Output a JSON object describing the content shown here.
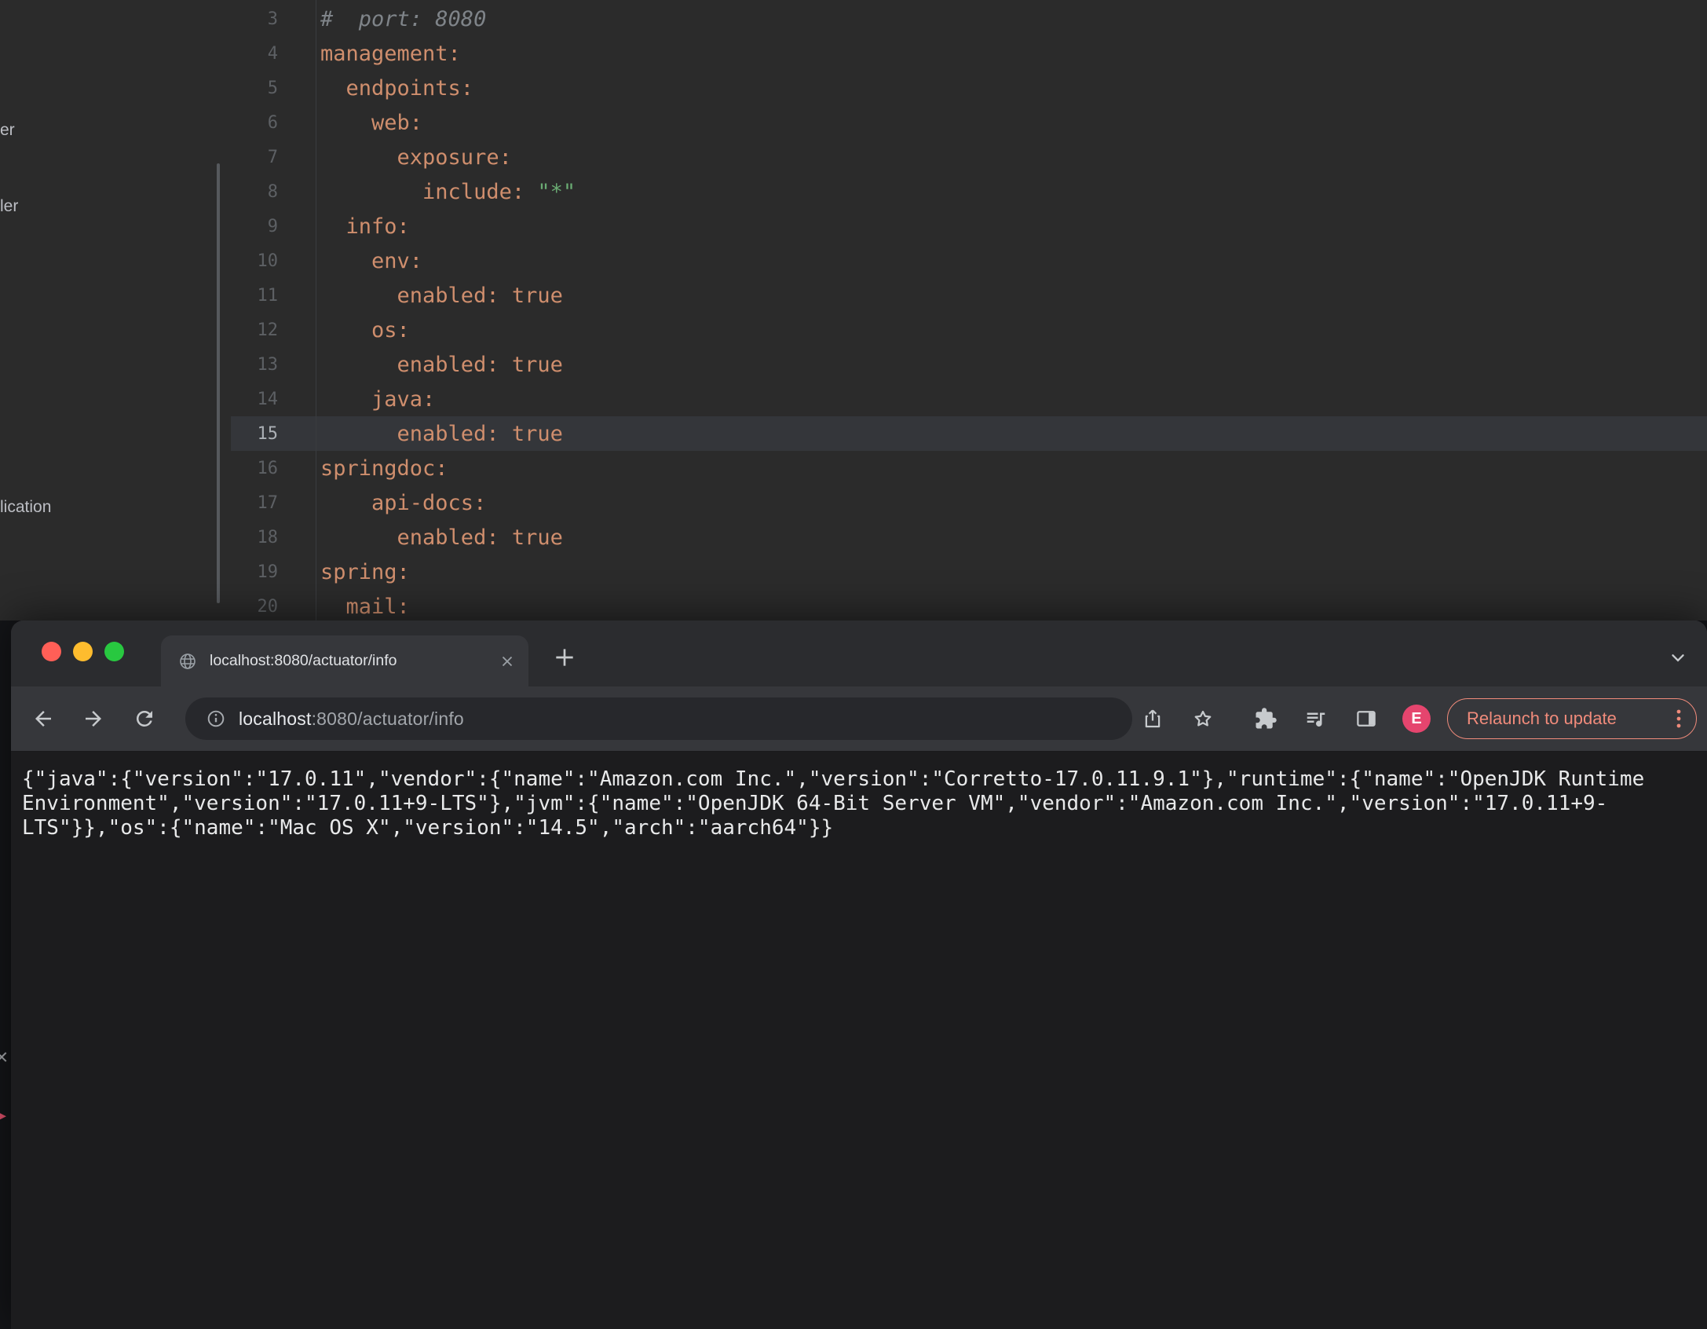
{
  "ide": {
    "sidebar_items": [
      {
        "label": "er"
      },
      {
        "label": "ler"
      },
      {
        "label": "lication"
      }
    ],
    "edge_glyphs": [
      "×",
      "▸"
    ],
    "editor_lines": [
      {
        "n": "3",
        "segs": [
          {
            "c": "comment",
            "t": "#  port: 8080"
          }
        ]
      },
      {
        "n": "4",
        "segs": [
          {
            "c": "key",
            "t": "management:"
          }
        ]
      },
      {
        "n": "5",
        "segs": [
          {
            "c": "key",
            "t": "  endpoints:"
          }
        ]
      },
      {
        "n": "6",
        "segs": [
          {
            "c": "key",
            "t": "    web:"
          }
        ]
      },
      {
        "n": "7",
        "segs": [
          {
            "c": "key",
            "t": "      exposure:"
          }
        ]
      },
      {
        "n": "8",
        "segs": [
          {
            "c": "key",
            "t": "        include: "
          },
          {
            "c": "string",
            "t": "\"*\""
          }
        ]
      },
      {
        "n": "9",
        "segs": [
          {
            "c": "key",
            "t": "  info:"
          }
        ]
      },
      {
        "n": "10",
        "segs": [
          {
            "c": "key",
            "t": "    env:"
          }
        ]
      },
      {
        "n": "11",
        "segs": [
          {
            "c": "key",
            "t": "      enabled: "
          },
          {
            "c": "value",
            "t": "true"
          }
        ]
      },
      {
        "n": "12",
        "segs": [
          {
            "c": "key",
            "t": "    os:"
          }
        ]
      },
      {
        "n": "13",
        "segs": [
          {
            "c": "key",
            "t": "      enabled: "
          },
          {
            "c": "value",
            "t": "true"
          }
        ]
      },
      {
        "n": "14",
        "segs": [
          {
            "c": "key",
            "t": "    java:"
          }
        ]
      },
      {
        "n": "15",
        "active": true,
        "segs": [
          {
            "c": "key",
            "t": "      enabled: "
          },
          {
            "c": "value",
            "t": "true"
          }
        ]
      },
      {
        "n": "16",
        "segs": [
          {
            "c": "key",
            "t": "springdoc:"
          }
        ]
      },
      {
        "n": "17",
        "segs": [
          {
            "c": "key",
            "t": "    api-docs:"
          }
        ]
      },
      {
        "n": "18",
        "segs": [
          {
            "c": "key",
            "t": "      enabled: "
          },
          {
            "c": "value",
            "t": "true"
          }
        ]
      },
      {
        "n": "19",
        "segs": [
          {
            "c": "key",
            "t": "spring:"
          }
        ]
      },
      {
        "n": "20",
        "segs": [
          {
            "c": "key",
            "t": "  mail:"
          }
        ]
      }
    ]
  },
  "browser": {
    "tab": {
      "title": "localhost:8080/actuator/info"
    },
    "address": {
      "host": "localhost",
      "path": ":8080/actuator/info"
    },
    "profile_initial": "E",
    "update_button": {
      "label": "Relaunch to update"
    },
    "content_json": "{\"java\":{\"version\":\"17.0.11\",\"vendor\":{\"name\":\"Amazon.com Inc.\",\"version\":\"Corretto-17.0.11.9.1\"},\"runtime\":{\"name\":\"OpenJDK Runtime Environment\",\"version\":\"17.0.11+9-LTS\"},\"jvm\":{\"name\":\"OpenJDK 64-Bit Server VM\",\"vendor\":\"Amazon.com Inc.\",\"version\":\"17.0.11+9-LTS\"}},\"os\":{\"name\":\"Mac OS X\",\"version\":\"14.5\",\"arch\":\"aarch64\"}}"
  },
  "icons": {
    "tab_favicon": "globe-icon",
    "toolbar": [
      "back-arrow-icon",
      "forward-arrow-icon",
      "reload-icon",
      "info-icon",
      "share-icon",
      "star-icon",
      "extensions-puzzle-icon",
      "media-playlist-icon",
      "side-panel-icon",
      "kebab-menu-icon"
    ]
  },
  "colors": {
    "traffic_red": "#ff5f57",
    "traffic_yellow": "#febc2e",
    "traffic_green": "#28c840",
    "avatar_bg": "#e5456e",
    "update_accent": "#f08b7b",
    "yaml_key": "#cf8e6d",
    "yaml_value": "#cf8e6d",
    "yaml_string": "#6aab73",
    "yaml_comment": "#7f8489"
  }
}
